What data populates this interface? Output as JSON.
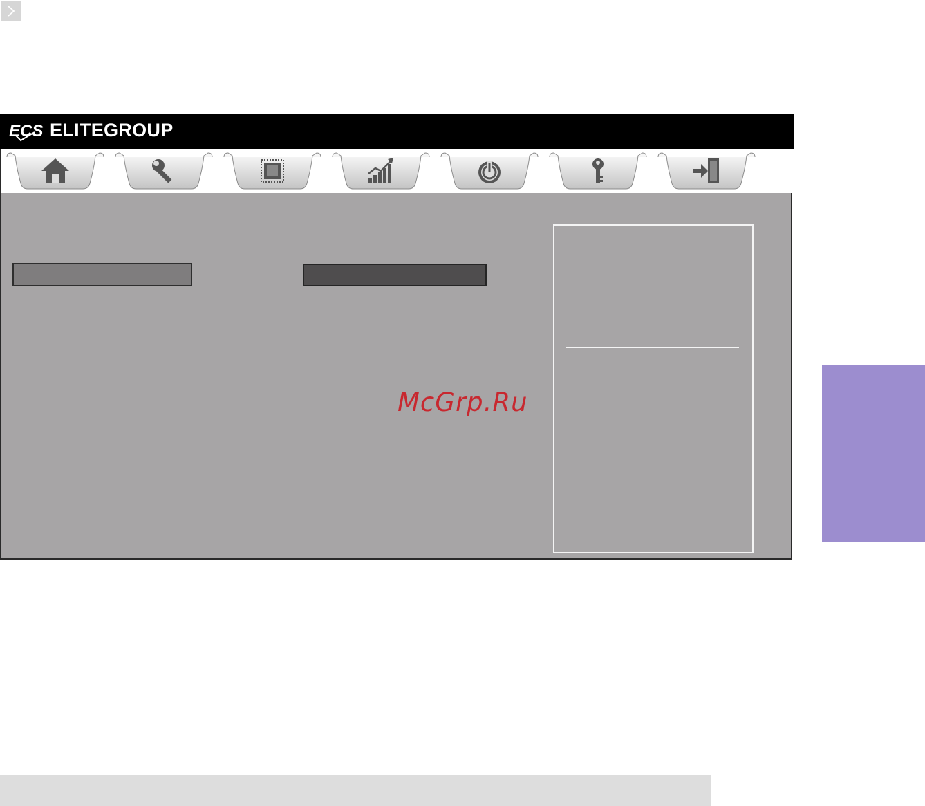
{
  "brand": {
    "logo_text": "ECS",
    "name": "ELITEGROUP"
  },
  "tabs": [
    {
      "icon": "home-icon"
    },
    {
      "icon": "wrench-icon"
    },
    {
      "icon": "chip-icon"
    },
    {
      "icon": "chart-icon"
    },
    {
      "icon": "power-icon"
    },
    {
      "icon": "key-icon"
    },
    {
      "icon": "exit-icon"
    }
  ],
  "watermark": "McGrp.Ru",
  "colors": {
    "panel_bg": "#a7a5a6",
    "side_tab": "#9c8dcf",
    "watermark": "#c8282f",
    "header_bg": "#000000"
  }
}
